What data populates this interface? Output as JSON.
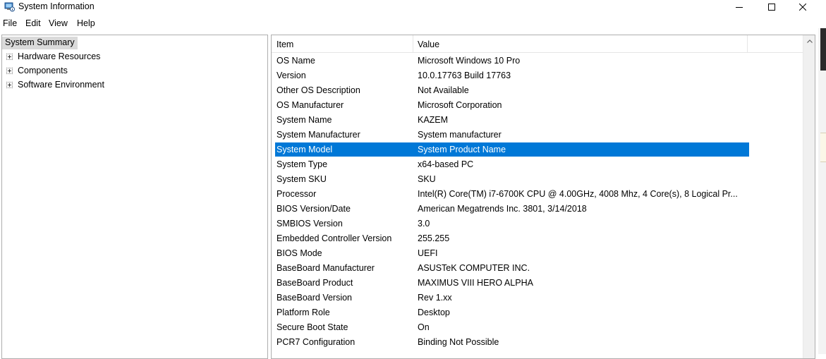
{
  "window": {
    "title": "System Information"
  },
  "menu": [
    "File",
    "Edit",
    "View",
    "Help"
  ],
  "tree": [
    {
      "label": "System Summary",
      "expandable": false,
      "selected": true
    },
    {
      "label": "Hardware Resources",
      "expandable": true,
      "selected": false
    },
    {
      "label": "Components",
      "expandable": true,
      "selected": false
    },
    {
      "label": "Software Environment",
      "expandable": true,
      "selected": false
    }
  ],
  "list": {
    "headers": {
      "item": "Item",
      "value": "Value"
    },
    "selected_color": "#0078d7",
    "rows": [
      {
        "item": "OS Name",
        "value": "Microsoft Windows 10 Pro"
      },
      {
        "item": "Version",
        "value": "10.0.17763 Build 17763"
      },
      {
        "item": "Other OS Description",
        "value": "Not Available"
      },
      {
        "item": "OS Manufacturer",
        "value": "Microsoft Corporation"
      },
      {
        "item": "System Name",
        "value": "KAZEM"
      },
      {
        "item": "System Manufacturer",
        "value": "System manufacturer"
      },
      {
        "item": "System Model",
        "value": "System Product Name",
        "selected": true
      },
      {
        "item": "System Type",
        "value": "x64-based PC"
      },
      {
        "item": "System SKU",
        "value": "SKU"
      },
      {
        "item": "Processor",
        "value": "Intel(R) Core(TM) i7-6700K CPU @ 4.00GHz, 4008 Mhz, 4 Core(s), 8 Logical Pr..."
      },
      {
        "item": "BIOS Version/Date",
        "value": "American Megatrends Inc. 3801, 3/14/2018"
      },
      {
        "item": "SMBIOS Version",
        "value": "3.0"
      },
      {
        "item": "Embedded Controller Version",
        "value": "255.255"
      },
      {
        "item": "BIOS Mode",
        "value": "UEFI"
      },
      {
        "item": "BaseBoard Manufacturer",
        "value": "ASUSTeK COMPUTER INC."
      },
      {
        "item": "BaseBoard Product",
        "value": "MAXIMUS VIII HERO ALPHA"
      },
      {
        "item": "BaseBoard Version",
        "value": "Rev 1.xx"
      },
      {
        "item": "Platform Role",
        "value": "Desktop"
      },
      {
        "item": "Secure Boot State",
        "value": "On"
      },
      {
        "item": "PCR7 Configuration",
        "value": "Binding Not Possible"
      }
    ]
  }
}
